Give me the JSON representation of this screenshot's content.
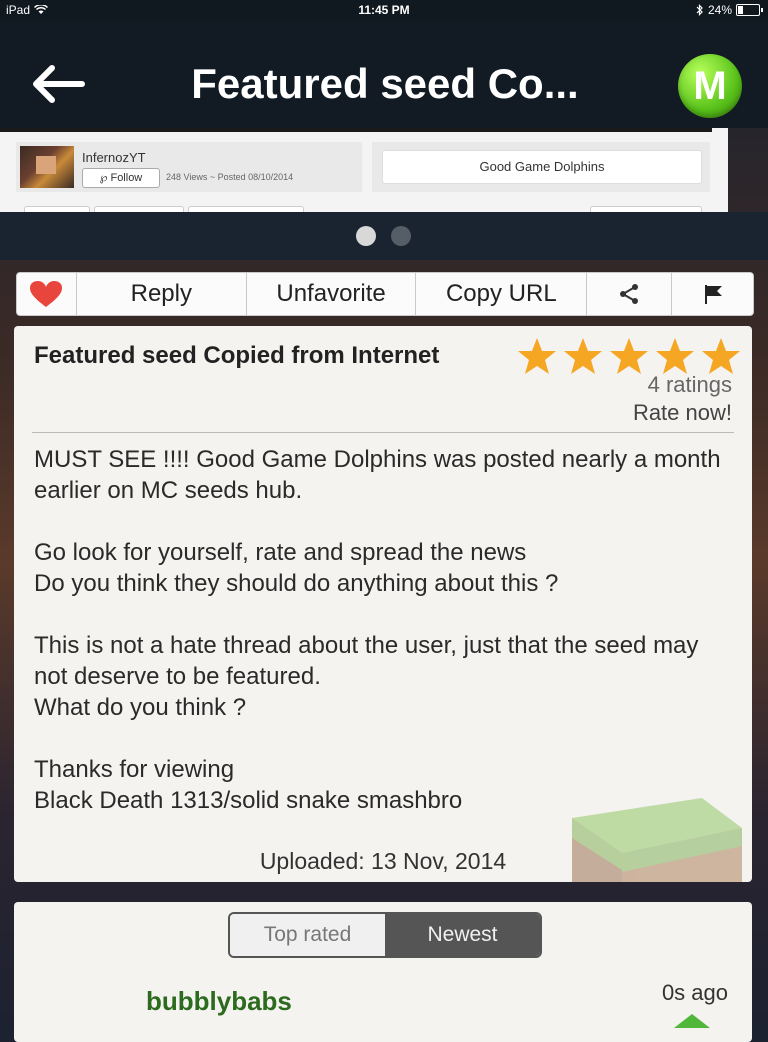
{
  "status_bar": {
    "device": "iPad",
    "time": "11:45 PM",
    "battery": "24%",
    "battery_level": 0.24
  },
  "nav": {
    "title": "Featured seed Co...",
    "logo_letter": "M"
  },
  "preview": {
    "username": "InfernozYT",
    "follow_label": "Follow",
    "views_posted": "248 Views ~ Posted 08/10/2014",
    "seed_name": "Good Game Dolphins"
  },
  "pager": {
    "pages": 2,
    "current": 1
  },
  "actions": {
    "reply": "Reply",
    "unfavorite": "Unfavorite",
    "copy_url": "Copy URL"
  },
  "post": {
    "title": "Featured seed Copied from Internet",
    "stars": 5,
    "ratings": "4 ratings",
    "rate_now": "Rate now!",
    "paragraphs": [
      "MUST SEE !!!! Good Game Dolphins was posted nearly a month earlier on MC seeds hub.",
      "Go look for yourself, rate and spread the news\nDo you think they should do anything about this ?",
      "This is not a hate thread about the user, just that the seed may not deserve to be featured.\nWhat do you think ?",
      "Thanks for viewing\nBlack Death 1313/solid snake smashbro"
    ],
    "uploaded": "Uploaded: 13 Nov, 2014"
  },
  "comments": {
    "sort_top": "Top rated",
    "sort_new": "Newest",
    "selected": "Newest",
    "first_user": "bubblybabs",
    "first_time": "0s ago"
  },
  "colors": {
    "nav_bg": "#121b24",
    "star": "#f5a623",
    "heart": "#e8453c",
    "username_green": "#2c6a1e",
    "logo_green": "#59c21a"
  }
}
